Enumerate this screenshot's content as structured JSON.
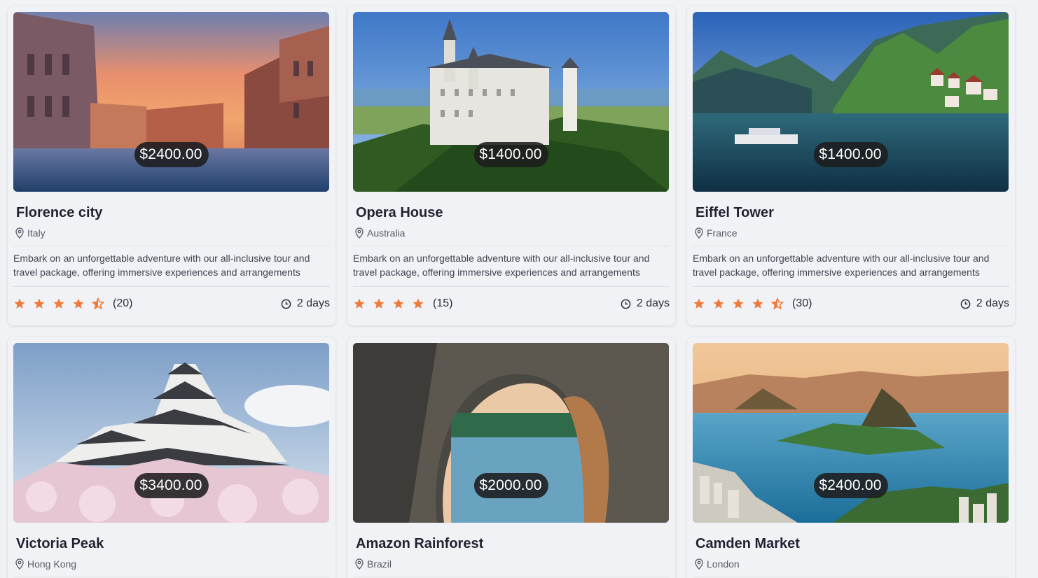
{
  "colors": {
    "star": "#f07a3a",
    "price_bg": "#1c1c1e",
    "background": "#f1f2f5"
  },
  "cards": [
    {
      "title": "Florence city",
      "location": "Italy",
      "price": "$2400.00",
      "description": "Embark on an unforgettable adventure with our all-inclusive tour and travel package, offering immersive experiences and arrangements",
      "rating": 4.5,
      "reviews": "(20)",
      "duration": "2 days",
      "image": "venice-canal-sunset"
    },
    {
      "title": "Opera House",
      "location": "Australia",
      "price": "$1400.00",
      "description": "Embark on an unforgettable adventure with our all-inclusive tour and travel package, offering immersive experiences and arrangements",
      "rating": 4,
      "reviews": "(15)",
      "duration": "2 days",
      "image": "castle-on-hill"
    },
    {
      "title": "Eiffel Tower",
      "location": "France",
      "price": "$1400.00",
      "description": "Embark on an unforgettable adventure with our all-inclusive tour and travel package, offering immersive experiences and arrangements",
      "rating": 4.5,
      "reviews": "(30)",
      "duration": "2 days",
      "image": "alpine-lake-village"
    },
    {
      "title": "Victoria Peak",
      "location": "Hong Kong",
      "price": "$3400.00",
      "image": "japanese-castle-cherry-blossoms"
    },
    {
      "title": "Amazon Rainforest",
      "location": "Brazil",
      "price": "$2000.00",
      "image": "rock-arch-lake"
    },
    {
      "title": "Camden Market",
      "location": "London",
      "price": "$2400.00",
      "image": "coastal-bay-aerial"
    }
  ]
}
